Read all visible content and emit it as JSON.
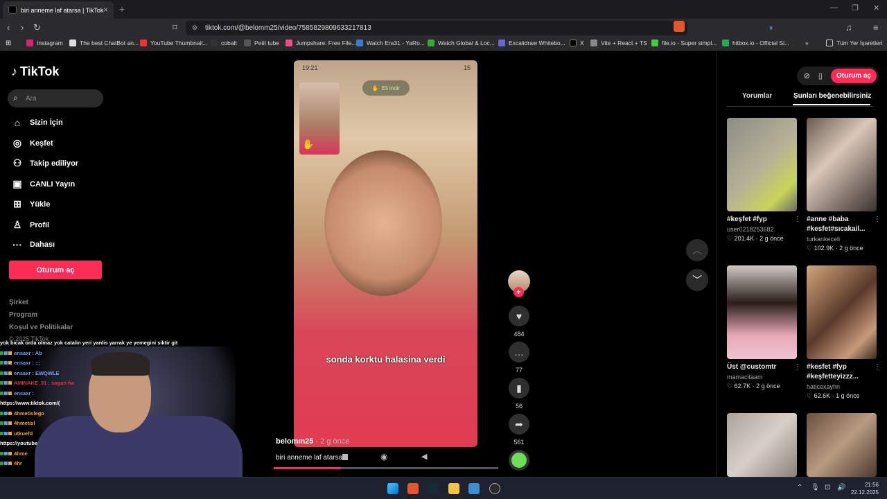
{
  "browser": {
    "tab_title": "biri anneme laf atarsa | TikTok",
    "url": "tiktok.com/@belomm25/video/7585829809633217813",
    "bookmarks": [
      "Instagram",
      "The best ChatBot an...",
      "YouTube Thumbnail...",
      "cobalt",
      "Petit tube",
      "Jumpshare: Free File...",
      "Watch Era31 - YaRo...",
      "Watch Global & Loc...",
      "Excalidraw Whitebo...",
      "X",
      "Vite + React + TS",
      "file.io - Super simpl...",
      "hitbox.io - Official Si..."
    ],
    "bookmark_folder": "Tüm Yer İşaretleri"
  },
  "sidebar": {
    "logo": "TikTok",
    "search_placeholder": "Ara",
    "items": [
      {
        "label": "Sizin İçin",
        "icon": "home-icon"
      },
      {
        "label": "Keşfet",
        "icon": "compass-icon"
      },
      {
        "label": "Takip ediliyor",
        "icon": "following-icon"
      },
      {
        "label": "CANLI Yayın",
        "icon": "live-icon"
      },
      {
        "label": "Yükle",
        "icon": "upload-icon"
      },
      {
        "label": "Profil",
        "icon": "profile-icon"
      },
      {
        "label": "Dahası",
        "icon": "more-icon"
      }
    ],
    "login": "Oturum aç",
    "footer": [
      "Şirket",
      "Program",
      "Koşul ve Politikalar",
      "© 2025 TikTok"
    ]
  },
  "video": {
    "phone_time": "19:21",
    "battery": "15",
    "raise_hand": "Eli indir",
    "caption": "sonda korktu halasina verdi",
    "username": "belomm25",
    "posted": "· 2 g önce",
    "description": "biri anneme laf atarsa",
    "progress": 0.3
  },
  "actions": {
    "likes": "484",
    "comments": "77",
    "saves": "56",
    "shares": "561"
  },
  "right_panel": {
    "login": "Oturum aç",
    "tabs": [
      "Yorumlar",
      "Şunları beğenebilirsiniz"
    ],
    "cards": [
      {
        "title": "#keşfet #fyp",
        "user": "user0218253682",
        "likes": "201.4K",
        "age": "2 g önce"
      },
      {
        "title": "#anne #baba #kesfet#sıcakail...",
        "user": "turkankeceli",
        "likes": "102.9K",
        "age": "2 g önce"
      },
      {
        "title": "Üst @customtr",
        "user": "mamacitaam",
        "likes": "62.7K",
        "age": "2 g önce"
      },
      {
        "title": "#kesfet #fyp #keşfetteyizzz...",
        "user": "haticexayhn",
        "likes": "62.6K",
        "age": "1 g önce"
      }
    ]
  },
  "chat": [
    "yok bicak orda olmaz yok catalin yeri yanlis yarrak ye yemegini siktir git",
    "ensaxr : Ab",
    "ensaxr : :::",
    "ensaxr : EWQWLE",
    "AMINAKE_31 : sogan ha",
    "ensaxr :",
    "https://www.tiktok.com/(",
    "4hmetislego",
    "4hmetisl",
    "utkuefd",
    "https://youtube",
    "4hme",
    "4hr"
  ],
  "taskbar": {
    "time": "21:56",
    "date": "22.12.2025"
  }
}
